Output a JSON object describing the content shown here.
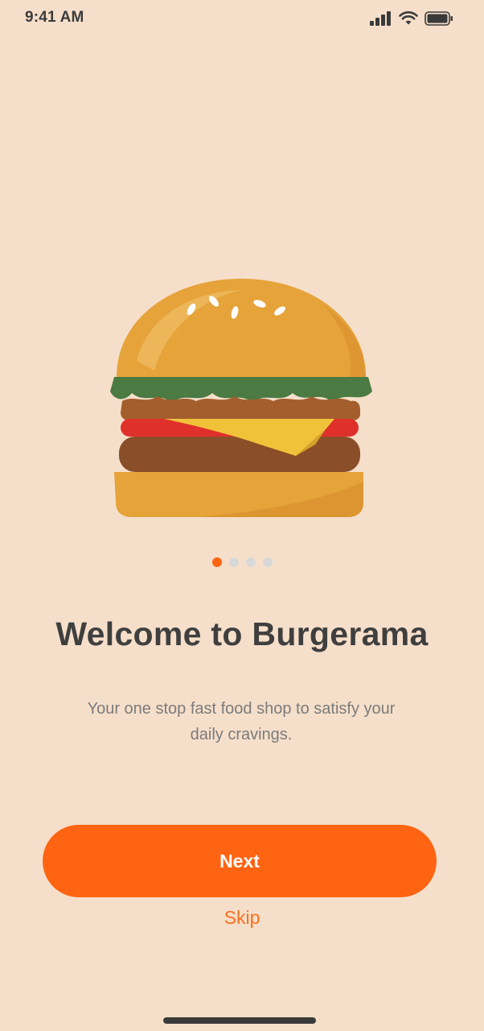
{
  "status_bar": {
    "time": "9:41 AM",
    "icons": [
      "signal-icon",
      "wifi-icon",
      "battery-icon"
    ]
  },
  "hero": {
    "icon": "burger-illustration"
  },
  "pager": {
    "total": 4,
    "active_index": 0
  },
  "onboarding": {
    "title": "Welcome to Burgerama",
    "subtitle": "Your one stop fast food shop to satisfy your daily cravings."
  },
  "actions": {
    "next_label": "Next",
    "skip_label": "Skip"
  },
  "colors": {
    "background": "#F6DFCA",
    "accent": "#FF6413",
    "title_text": "#3F3F3F",
    "body_text": "#7B7B7B",
    "dot_inactive": "#D9D8D8"
  }
}
